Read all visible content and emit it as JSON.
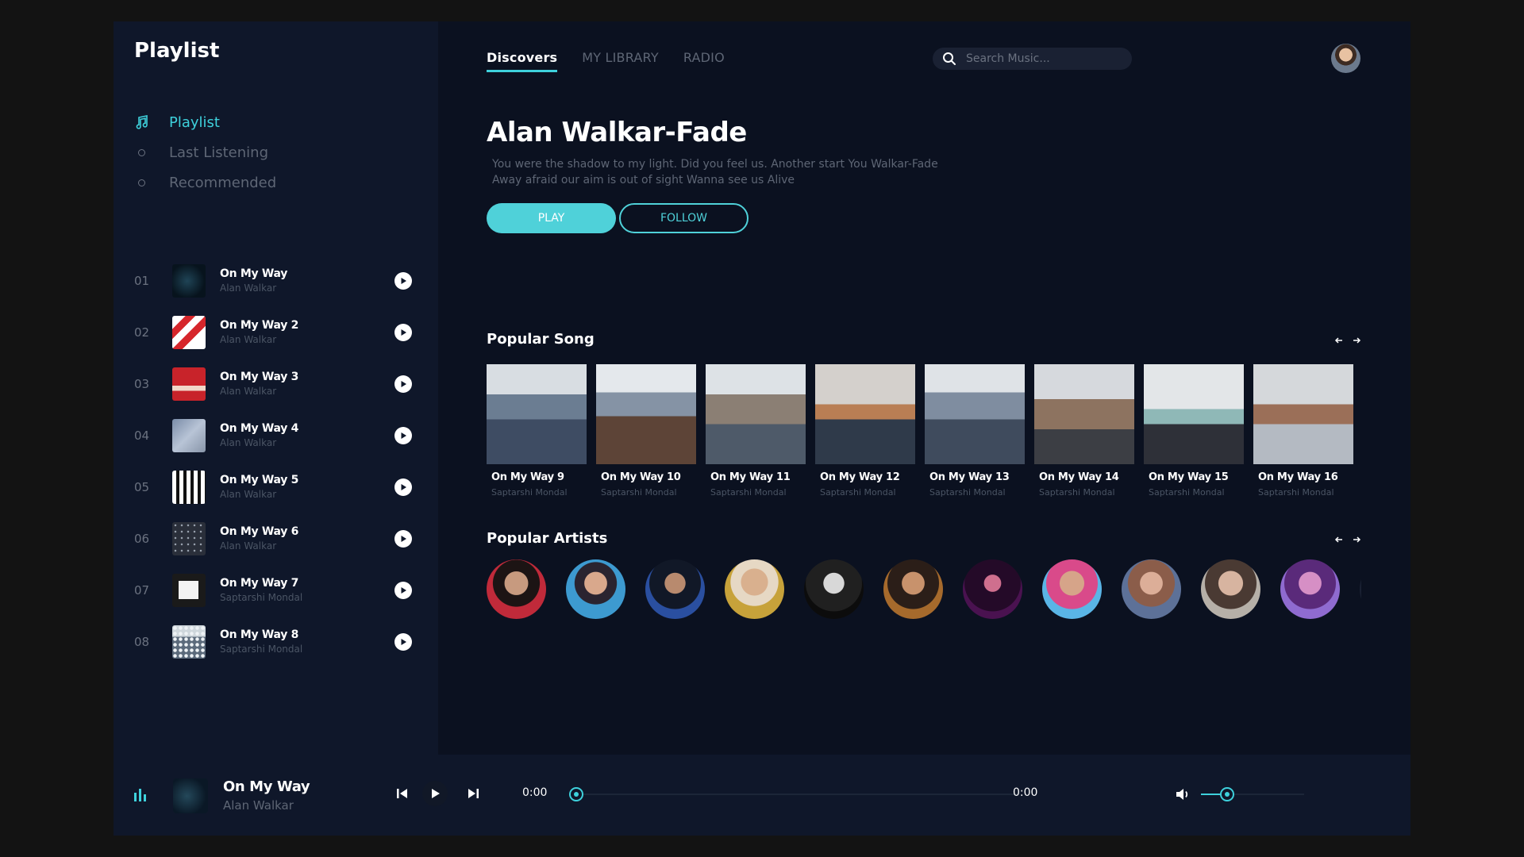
{
  "sidebar": {
    "title": "Playlist",
    "nav": [
      {
        "label": "Playlist",
        "icon": "music-note-icon",
        "active": true
      },
      {
        "label": "Last Listening",
        "icon": "circle-dot-icon",
        "active": false
      },
      {
        "label": "Recommended",
        "icon": "circle-dot-icon",
        "active": false
      }
    ],
    "tracks": [
      {
        "num": "01",
        "title": "On My Way",
        "artist": "Alan Walkar",
        "cover": "dark-teal"
      },
      {
        "num": "02",
        "title": "On My Way 2",
        "artist": "Alan Walkar",
        "cover": "red-white"
      },
      {
        "num": "03",
        "title": "On My Way 3",
        "artist": "Alan Walkar",
        "cover": "red"
      },
      {
        "num": "04",
        "title": "On My Way 4",
        "artist": "Alan Walkar",
        "cover": "blue-grey"
      },
      {
        "num": "05",
        "title": "On My Way 5",
        "artist": "Alan Walkar",
        "cover": "white-black"
      },
      {
        "num": "06",
        "title": "On My Way 6",
        "artist": "Alan Walkar",
        "cover": "grey-grid"
      },
      {
        "num": "07",
        "title": "On My Way 7",
        "artist": "Saptarshi Mondal",
        "cover": "black-white"
      },
      {
        "num": "08",
        "title": "On My Way 8",
        "artist": "Saptarshi Mondal",
        "cover": "crowd"
      }
    ]
  },
  "header": {
    "tabs": [
      {
        "label": "Discovers",
        "active": true
      },
      {
        "label": "MY LIBRARY",
        "active": false
      },
      {
        "label": "RADIO",
        "active": false
      }
    ],
    "search": {
      "placeholder": "Search Music..."
    }
  },
  "hero": {
    "title": "Alan Walkar-Fade",
    "description": "You were the shadow to my light. Did you feel us. Another start You Walkar-Fade Away afraid our aim is out of sight Wanna see us Alive",
    "play_label": "PLAY",
    "follow_label": "FOLLOW"
  },
  "popular_songs": {
    "title": "Popular Song",
    "items": [
      {
        "title": "On My Way 9",
        "artist": "Saptarshi Mondal"
      },
      {
        "title": "On My Way 10",
        "artist": "Saptarshi Mondal"
      },
      {
        "title": "On My Way 11",
        "artist": "Saptarshi Mondal"
      },
      {
        "title": "On My Way 12",
        "artist": "Saptarshi Mondal"
      },
      {
        "title": "On My Way 13",
        "artist": "Saptarshi Mondal"
      },
      {
        "title": "On My Way 14",
        "artist": "Saptarshi Mondal"
      },
      {
        "title": "On My Way 15",
        "artist": "Saptarshi Mondal"
      },
      {
        "title": "On My Way 16",
        "artist": "Saptarshi Mondal"
      }
    ]
  },
  "popular_artists": {
    "title": "Popular Artists",
    "count": 11
  },
  "player": {
    "title": "On My Way",
    "artist": "Alan Walkar",
    "current_time": "0:00",
    "total_time": "0:00",
    "progress": 0,
    "volume": 0.25
  },
  "colors": {
    "accent": "#3ed1dc",
    "background": "#0b1120",
    "sidebar": "#0f172a"
  }
}
